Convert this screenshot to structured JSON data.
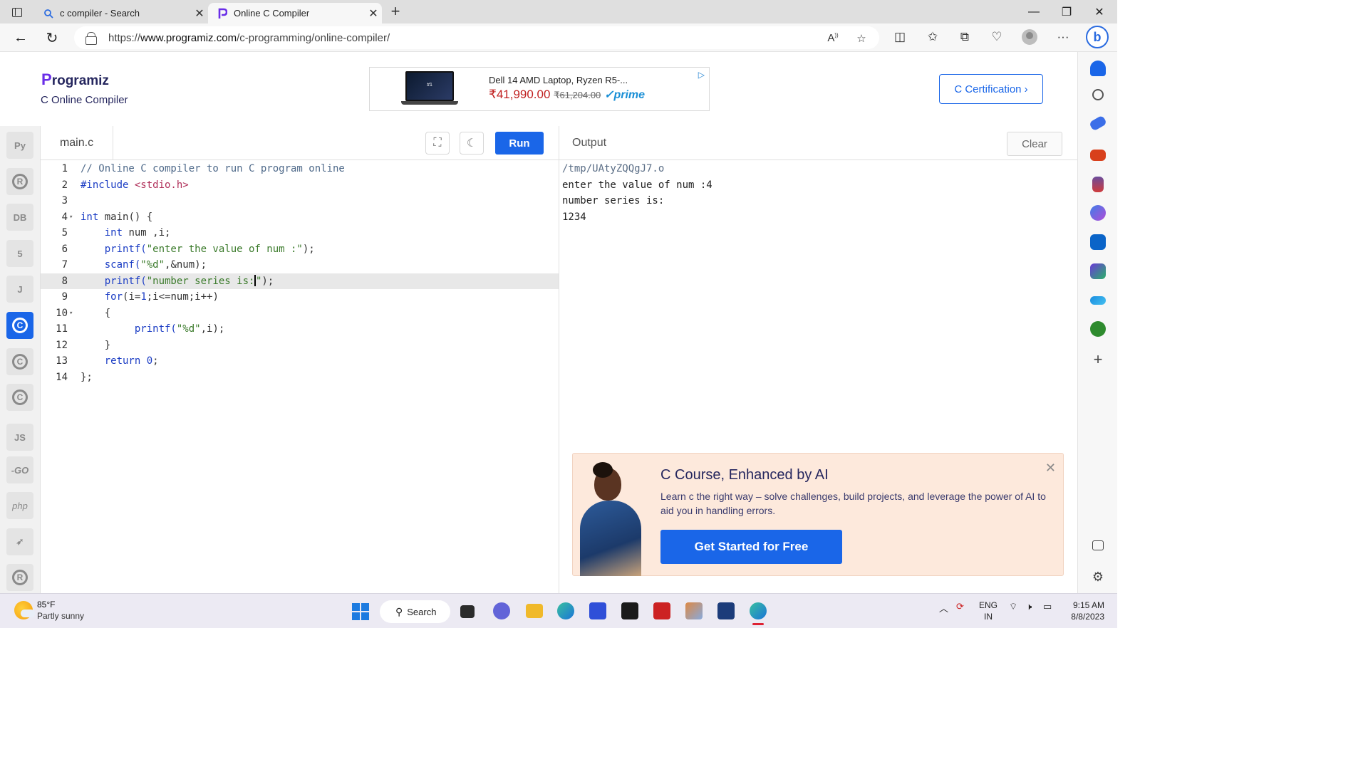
{
  "browser": {
    "tabs": [
      {
        "title": "c compiler - Search",
        "active": false
      },
      {
        "title": "Online C Compiler",
        "active": true
      }
    ],
    "url_prefix": "https://",
    "url_domain": "www.programiz.com",
    "url_path": "/c-programming/online-compiler/",
    "window_controls": {
      "minimize": "—",
      "restore": "❐",
      "close": "✕"
    }
  },
  "header": {
    "brand_initial": "P",
    "brand_name": "rogramiz",
    "subtitle": "C Online Compiler",
    "certification_button": "C Certification ›"
  },
  "ad": {
    "title": "Dell 14 AMD Laptop, Ryzen R5-...",
    "price": "₹41,990.00",
    "old_price": "₹61,204.00",
    "prime": "✓prime",
    "screen_text": "#1"
  },
  "languages": [
    {
      "name": "python-icon",
      "glyph": "Py",
      "active": false
    },
    {
      "name": "r-icon",
      "glyph": "R",
      "active": false
    },
    {
      "name": "sql-icon",
      "glyph": "DB",
      "active": false
    },
    {
      "name": "html-icon",
      "glyph": "5",
      "active": false
    },
    {
      "name": "java-icon",
      "glyph": "J",
      "active": false
    },
    {
      "name": "c-icon",
      "glyph": "C",
      "active": true
    },
    {
      "name": "cpp-icon",
      "glyph": "C+",
      "active": false
    },
    {
      "name": "csharp-icon",
      "glyph": "C#",
      "active": false
    },
    {
      "name": "js-icon",
      "glyph": "JS",
      "active": false
    },
    {
      "name": "go-icon",
      "glyph": "-GO",
      "active": false
    },
    {
      "name": "php-icon",
      "glyph": "php",
      "active": false
    },
    {
      "name": "swift-icon",
      "glyph": "➶",
      "active": false
    },
    {
      "name": "rust-icon",
      "glyph": "®",
      "active": false
    }
  ],
  "editor": {
    "filename": "main.c",
    "run_label": "Run",
    "lines": [
      "1",
      "2",
      "3",
      "4",
      "5",
      "6",
      "7",
      "8",
      "9",
      "10",
      "11",
      "12",
      "13",
      "14"
    ],
    "code": {
      "l1": "// Online C compiler to run C program online",
      "l2a": "#include ",
      "l2b": "<stdio.h>",
      "l4a": "int",
      "l4b": " main() {",
      "l5a": "    int",
      "l5b": " num ,i;",
      "l6a": "    printf(",
      "l6b": "\"enter the value of num :\"",
      "l6c": ");",
      "l7a": "    scanf(",
      "l7b": "\"%d\"",
      "l7c": ",&num);",
      "l8a": "    printf(",
      "l8b": "\"number series is:",
      "l8c": "\"",
      "l8d": ");",
      "l9a": "    for",
      "l9b": "(i=",
      "l9c": "1",
      "l9d": ";i<=num;i++)",
      "l10": "    {",
      "l11a": "         printf(",
      "l11b": "\"%d\"",
      "l11c": ",i);",
      "l12": "    }",
      "l13a": "    return",
      "l13b": " ",
      "l13c": "0",
      "l13d": ";",
      "l14": "};"
    }
  },
  "output": {
    "title": "Output",
    "clear_label": "Clear",
    "lines": [
      "/tmp/UAtyZQQgJ7.o",
      "enter the value of num :4",
      "number series is:",
      "1234"
    ]
  },
  "promo": {
    "heading": "C Course, Enhanced by AI",
    "description": "Learn c the right way – solve challenges, build projects, and leverage the power of AI to aid you in handling errors.",
    "cta": "Get Started for Free"
  },
  "taskbar": {
    "temperature": "85°F",
    "condition": "Partly sunny",
    "search_label": "Search",
    "lang_line1": "ENG",
    "lang_line2": "IN",
    "time": "9:15 AM",
    "date": "8/8/2023"
  },
  "colors": {
    "accent": "#1a66e8",
    "brand": "#25265e",
    "promo_bg": "#fde9dc"
  }
}
